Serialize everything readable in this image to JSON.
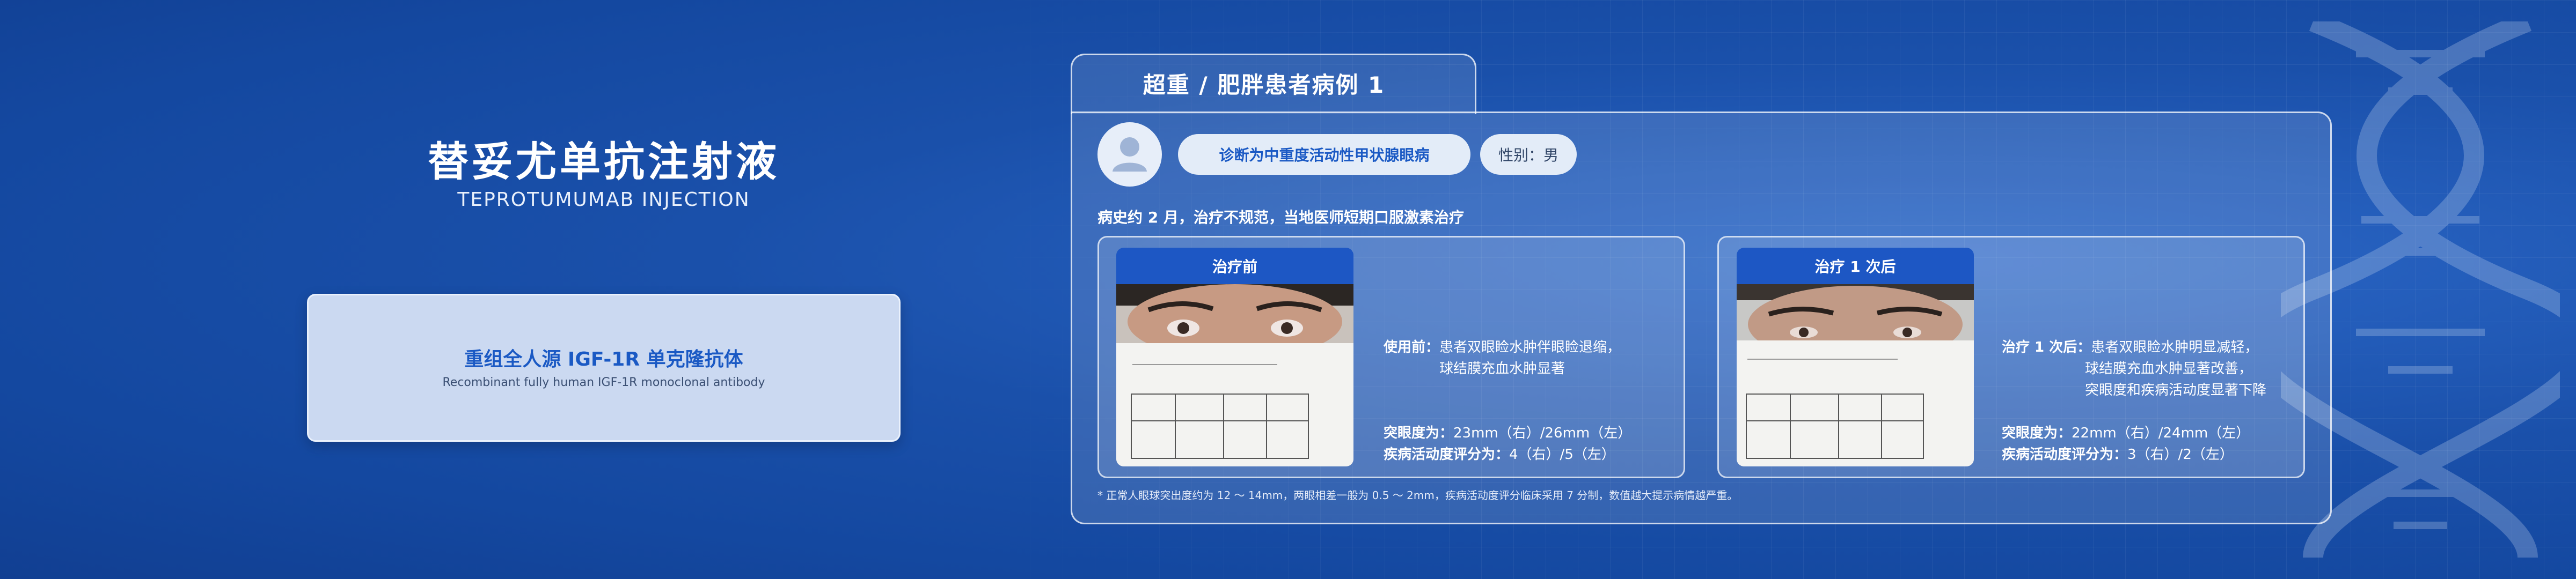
{
  "brand": {
    "title": "替妥尤单抗注射液",
    "subtitle": "TEPROTUMUMAB INJECTION",
    "box_title": "重组全人源 IGF-1R 单克隆抗体",
    "box_subtitle": "Recombinant fully human IGF-1R monoclonal antibody"
  },
  "case": {
    "tab_label": "超重 / 肥胖患者病例 1",
    "diagnosis": "诊断为中重度活动性甲状腺眼病",
    "sex": "性别：男",
    "history": "病史约 2 月，治疗不规范，当地医师短期口服激素治疗",
    "before": {
      "header": "治疗前",
      "label": "使用前：",
      "line1": "患者双眼睑水肿伴眼睑退缩，",
      "line2": "球结膜充血水肿显著",
      "proptosis_label": "突眼度为：",
      "proptosis_value": "23mm（右）/26mm（左）",
      "cas_label": "疾病活动度评分为：",
      "cas_value": "4（右）/5（左）"
    },
    "after": {
      "header": "治疗 1 次后",
      "label": "治疗 1 次后：",
      "line1": "患者双眼睑水肿明显减轻，",
      "line2": "球结膜充血水肿显著改善，",
      "line3": "突眼度和疾病活动度显著下降",
      "proptosis_label": "突眼度为：",
      "proptosis_value": "22mm（右）/24mm（左）",
      "cas_label": "疾病活动度评分为：",
      "cas_value": "3（右）/2（左）"
    },
    "footnote": "* 正常人眼球突出度约为 12 ～ 14mm，两眼相差一般为 0.5 ～ 2mm，疾病活动度评分临床采用 7 分制，数值越大提示病情越严重。"
  },
  "icons": {
    "avatar": "user-avatar-icon",
    "decoration": "dna-helix-icon"
  },
  "colors": {
    "background": "#1a50aa",
    "accent": "#1d57c4",
    "pill": "#e3ecf8"
  }
}
